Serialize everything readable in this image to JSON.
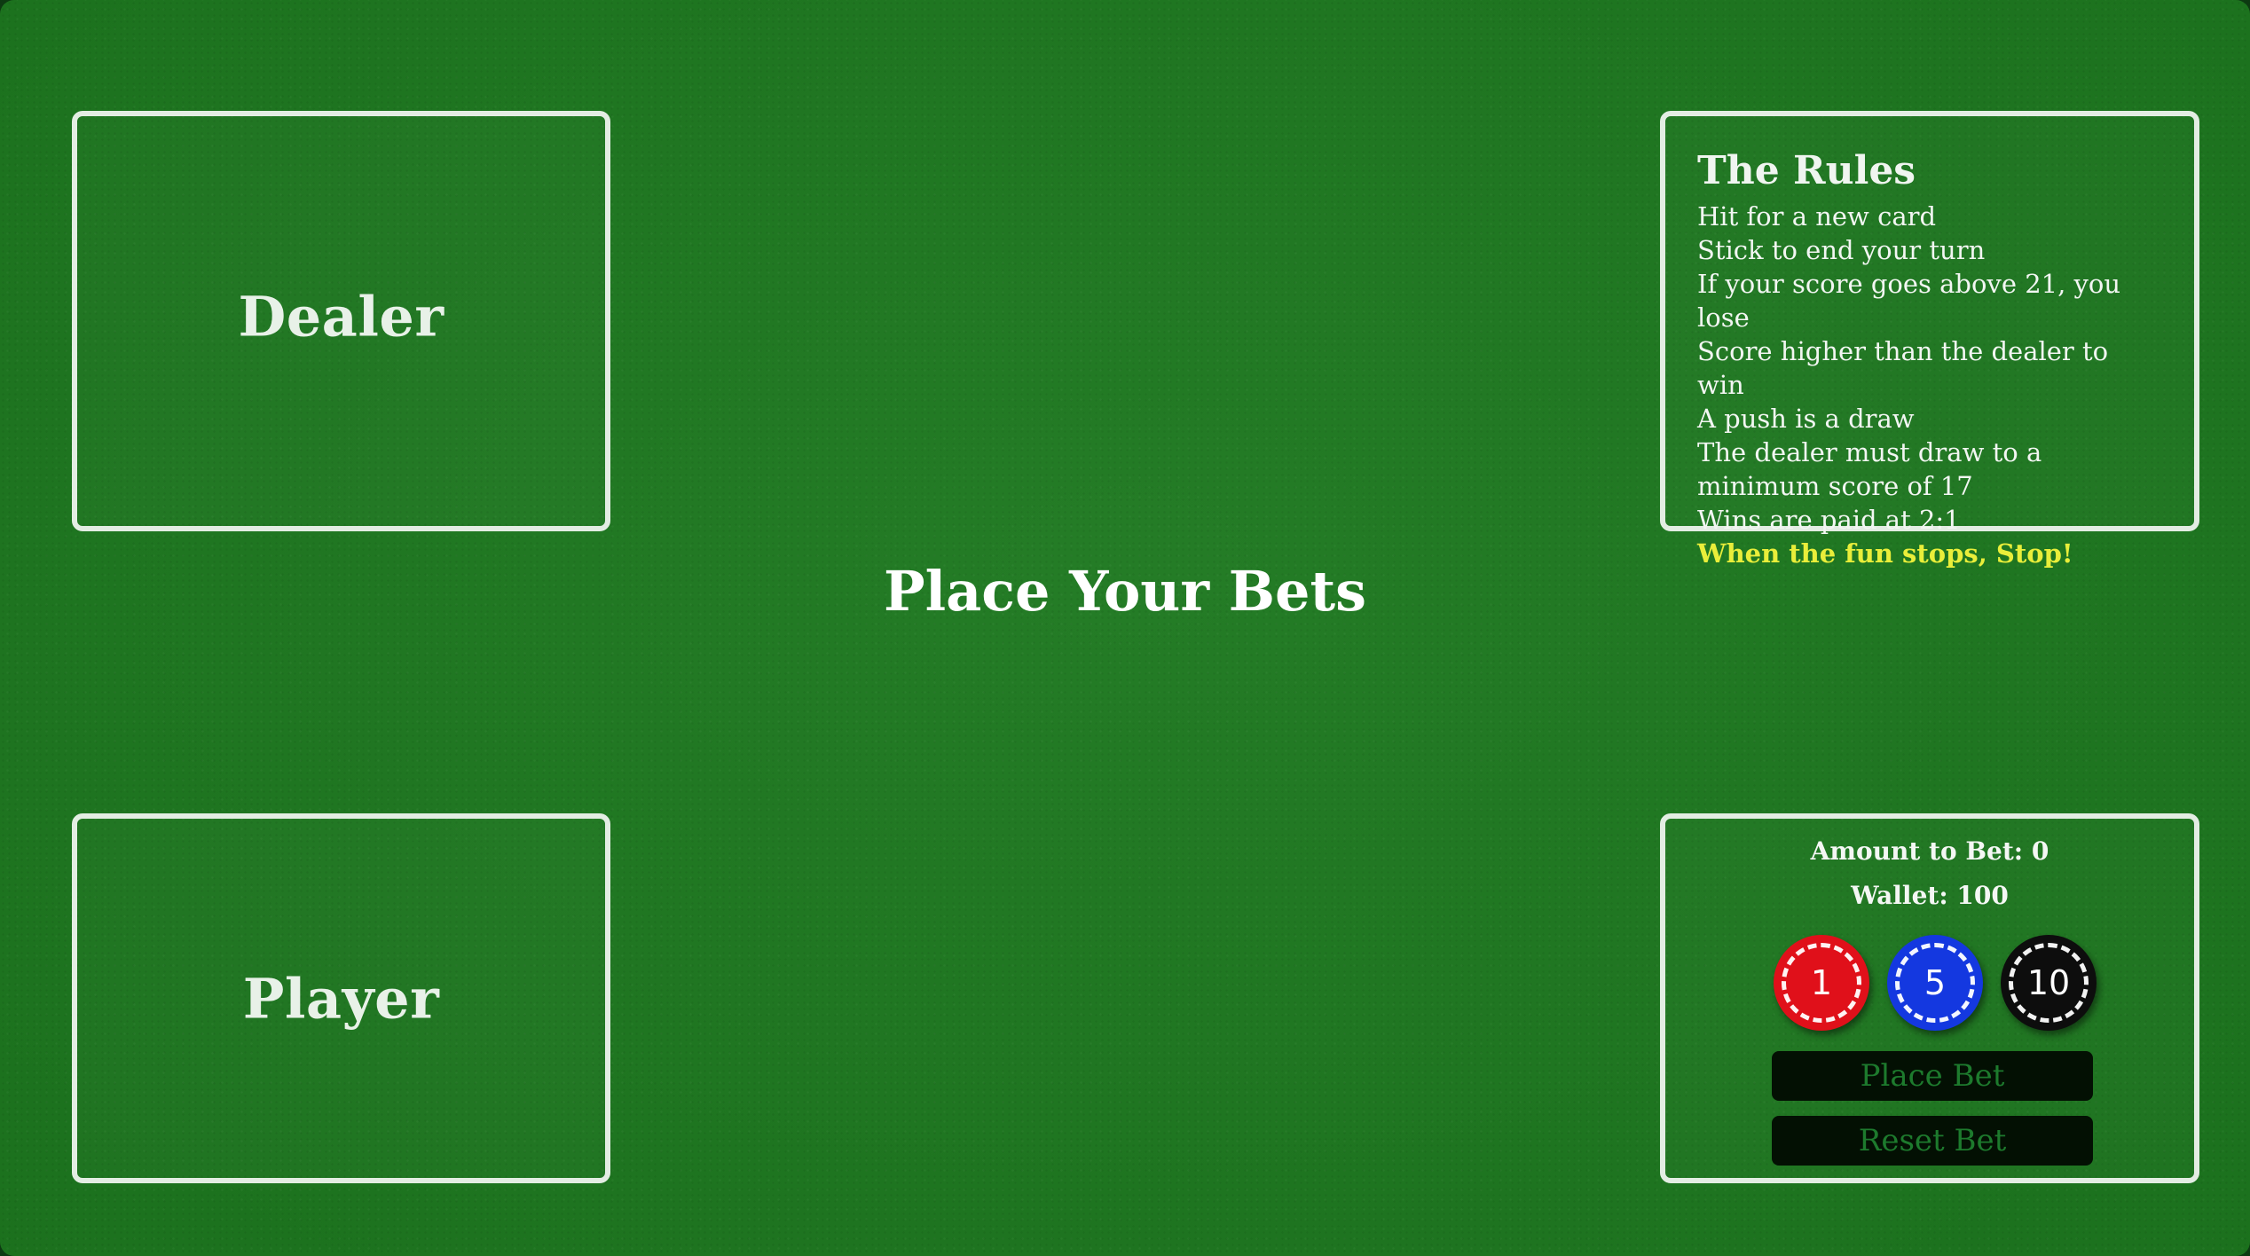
{
  "dealer": {
    "label": "Dealer"
  },
  "player": {
    "label": "Player"
  },
  "status": {
    "message": "Place Your Bets"
  },
  "rules": {
    "title": "The Rules",
    "items": [
      "Hit for a new card",
      "Stick to end your turn",
      "If your score goes above 21, you lose",
      "Score higher than the dealer to win",
      "A push is a draw",
      "The dealer must draw to a minimum score of 17",
      "Wins are paid at 2:1"
    ],
    "warning": "When the fun stops, Stop!"
  },
  "betting": {
    "amount_text": "Amount to Bet: 0",
    "wallet_text": "Wallet: 100",
    "chips": [
      {
        "value": "1",
        "color": "#e0101a"
      },
      {
        "value": "5",
        "color": "#1438e0"
      },
      {
        "value": "10",
        "color": "#0d0d0d"
      }
    ],
    "place_bet_label": "Place Bet",
    "reset_bet_label": "Reset Bet"
  },
  "colors": {
    "felt": "#1d781f",
    "border": "#e3ede3",
    "warning": "#e9ee3a",
    "button_bg": "#031003",
    "button_text": "#1d7a2d"
  }
}
